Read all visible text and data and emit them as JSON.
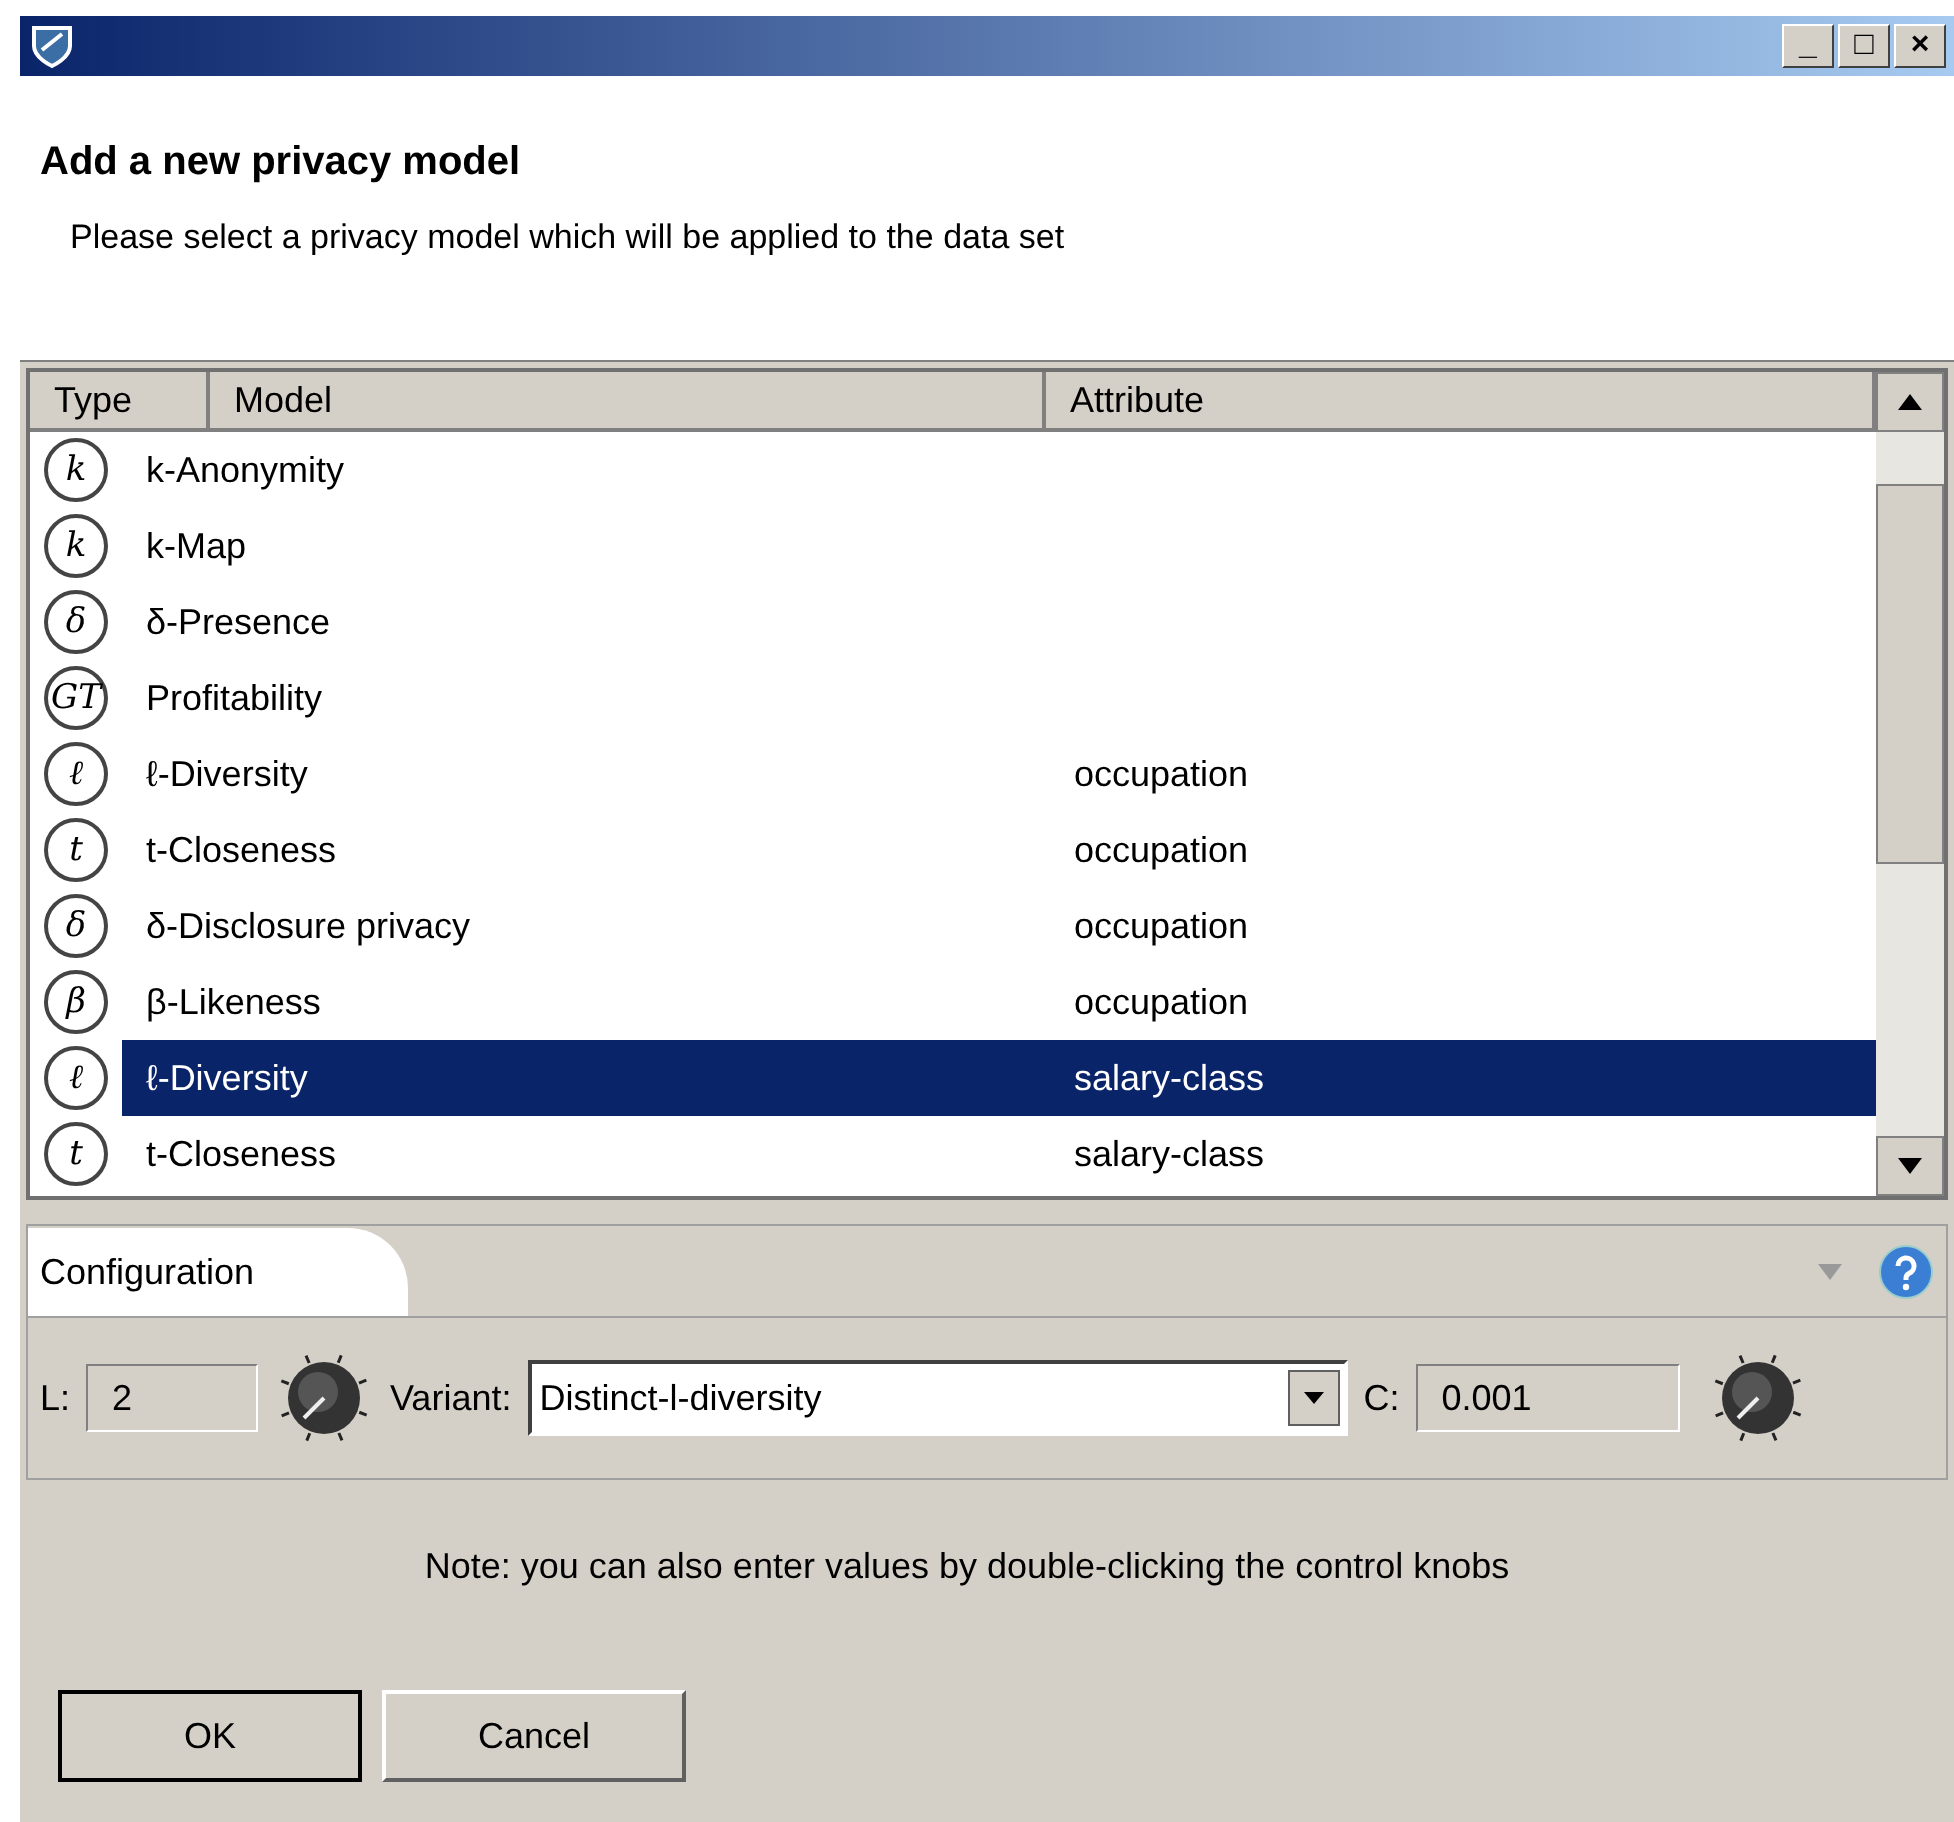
{
  "window": {
    "title_buttons": [
      "_",
      "□",
      "×"
    ]
  },
  "header": {
    "title": "Add a new privacy model",
    "subtitle": "Please select a privacy model which will be applied to the data set"
  },
  "table": {
    "columns": [
      "Type",
      "Model",
      "Attribute"
    ],
    "rows": [
      {
        "type": "k",
        "model": "k-Anonymity",
        "attribute": "",
        "selected": false
      },
      {
        "type": "k",
        "model": "k-Map",
        "attribute": "",
        "selected": false
      },
      {
        "type": "δ",
        "model": "δ-Presence",
        "attribute": "",
        "selected": false
      },
      {
        "type": "GT",
        "model": "Profitability",
        "attribute": "",
        "selected": false
      },
      {
        "type": "ℓ",
        "model": "ℓ-Diversity",
        "attribute": "occupation",
        "selected": false
      },
      {
        "type": "t",
        "model": "t-Closeness",
        "attribute": "occupation",
        "selected": false
      },
      {
        "type": "δ",
        "model": "δ-Disclosure privacy",
        "attribute": "occupation",
        "selected": false
      },
      {
        "type": "β",
        "model": "β-Likeness",
        "attribute": "occupation",
        "selected": false
      },
      {
        "type": "ℓ",
        "model": "ℓ-Diversity",
        "attribute": "salary-class",
        "selected": true
      },
      {
        "type": "t",
        "model": "t-Closeness",
        "attribute": "salary-class",
        "selected": false
      }
    ]
  },
  "configuration": {
    "tab": "Configuration",
    "l_label": "L:",
    "l_value": "2",
    "variant_label": "Variant:",
    "variant_value": "Distinct-l-diversity",
    "c_label": "C:",
    "c_value": "0.001"
  },
  "note": "Note: you can also enter values by double-clicking the control knobs",
  "buttons": [
    "OK",
    "Cancel"
  ]
}
